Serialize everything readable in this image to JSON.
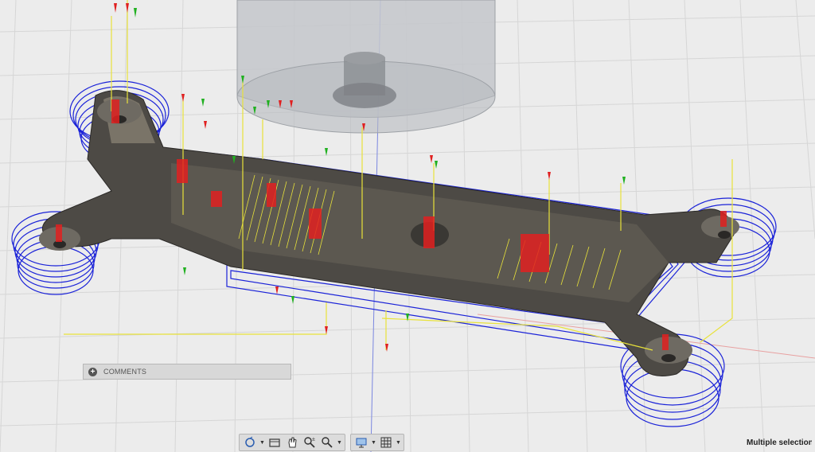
{
  "comments": {
    "label": "COMMENTS"
  },
  "status": {
    "selection_text": "Multiple selections"
  },
  "icons": [
    "orbit-icon",
    "look-at-icon",
    "pan-icon",
    "zoom-icon",
    "zoom-window-icon",
    "display-settings-icon",
    "grid-settings-icon"
  ],
  "colors": {
    "toolpath_blue": "#1a22d8",
    "part_grey": "#4d4a45",
    "rapid_yellow": "#e8e23a",
    "arrow_red": "#e02020",
    "arrow_green": "#20b020",
    "background": "#ececec"
  }
}
